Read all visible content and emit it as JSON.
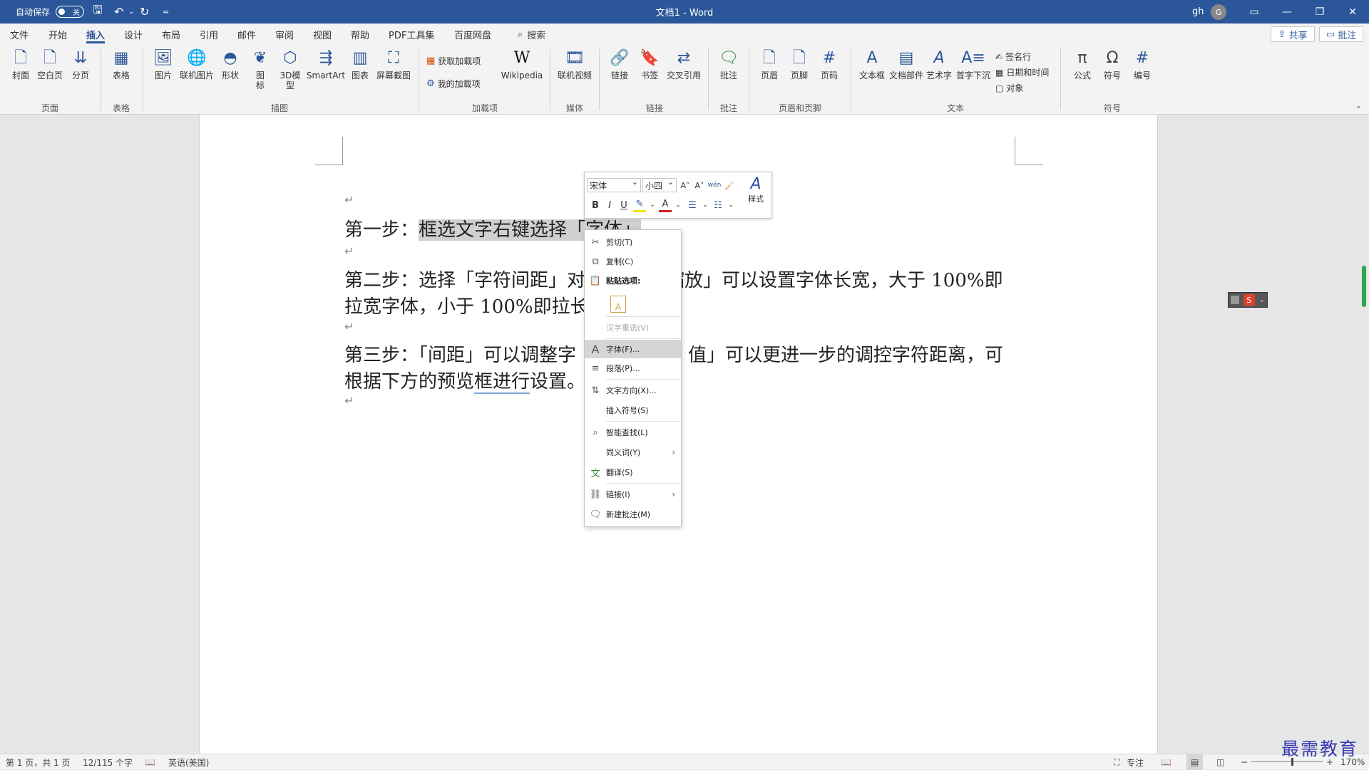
{
  "titlebar": {
    "autosave_label": "自动保存",
    "autosave_state": "关",
    "doc_title": "文档1 - Word",
    "user_name": "gh",
    "user_initial": "G"
  },
  "menu": {
    "tabs": [
      "文件",
      "开始",
      "插入",
      "设计",
      "布局",
      "引用",
      "邮件",
      "审阅",
      "视图",
      "帮助",
      "PDF工具集",
      "百度网盘"
    ],
    "active_tab": "插入",
    "search_label": "搜索",
    "share_label": "共享",
    "comment_label": "批注"
  },
  "ribbon": {
    "pages": {
      "cover": "封面",
      "blank": "空白页",
      "break": "分页",
      "group": "页面"
    },
    "tables": {
      "table": "表格",
      "group": "表格"
    },
    "illustrations": {
      "picture": "图片",
      "online_picture": "联机图片",
      "shapes": "形状",
      "icons": "图标",
      "model_3d": "3D模型",
      "smartart": "SmartArt",
      "chart": "图表",
      "screenshot": "屏幕截图",
      "group": "插图"
    },
    "addins": {
      "get": "获取加载项",
      "my": "我的加载项",
      "wikipedia": "Wikipedia",
      "group": "加载项"
    },
    "media": {
      "online_video": "联机视频",
      "group": "媒体"
    },
    "links": {
      "link": "链接",
      "bookmark": "书签",
      "cross_ref": "交叉引用",
      "group": "链接"
    },
    "comments": {
      "comment": "批注",
      "group": "批注"
    },
    "header_footer": {
      "header": "页眉",
      "footer": "页脚",
      "page_number": "页码",
      "group": "页眉和页脚"
    },
    "text": {
      "textbox": "文本框",
      "quick_parts": "文档部件",
      "wordart": "艺术字",
      "dropcap": "首字下沉",
      "signature": "签名行",
      "datetime": "日期和时间",
      "object": "对象",
      "group": "文本"
    },
    "symbols": {
      "equation": "公式",
      "symbol": "符号",
      "number": "编号",
      "group": "符号"
    }
  },
  "document": {
    "line1_prefix": "第一步：",
    "line1_selected": "框选文字右键选择「字体」",
    "line2": "第二步：选择「字符间距」对",
    "line2_tail": "缩放」可以设置字体长宽，大于 100%即",
    "line3": "拉宽字体，小于 100%即拉长",
    "line4": "第三步：「间距」可以调整字",
    "line4_tail": "值」可以更进一步的调控字符距离，可",
    "line5_a": "根据下方的预览",
    "line5_b": "框进行",
    "line5_c": "设置。",
    "para_mark": "↵"
  },
  "mini_toolbar": {
    "font": "宋体",
    "size": "小四",
    "grow": "A˄",
    "shrink": "A˅",
    "phonetic": "wén",
    "format_painter": "🖌",
    "bold": "B",
    "italic": "I",
    "underline": "U",
    "highlight": "✎",
    "font_color": "A",
    "bullets": "☰",
    "numbering": "☷",
    "styles_label": "样式"
  },
  "context_menu": {
    "cut": "剪切(T)",
    "copy": "复制(C)",
    "paste_options": "粘贴选项:",
    "hanzi_reselect": "汉字重选(V)",
    "font": "字体(F)...",
    "paragraph": "段落(P)...",
    "text_direction": "文字方向(X)...",
    "insert_symbol": "插入符号(S)",
    "smart_lookup": "智能查找(L)",
    "synonyms": "同义词(Y)",
    "translate": "翻译(S)",
    "link": "链接(I)",
    "new_comment": "新建批注(M)"
  },
  "statusbar": {
    "page": "第 1 页，共 1 页",
    "words": "12/115 个字",
    "language": "英语(美国)",
    "focus": "专注",
    "zoom": "170%"
  },
  "watermark": "最需教育"
}
